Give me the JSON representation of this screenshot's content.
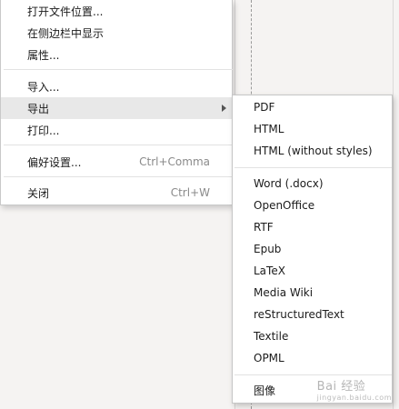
{
  "main_menu": {
    "items": [
      {
        "label": "打开文件位置..."
      },
      {
        "label": "在侧边栏中显示"
      },
      {
        "label": "属性..."
      },
      {
        "label": "导入..."
      },
      {
        "label": "导出"
      },
      {
        "label": "打印..."
      },
      {
        "label": "偏好设置...",
        "shortcut": "Ctrl+Comma"
      },
      {
        "label": "关闭",
        "shortcut": "Ctrl+W"
      }
    ]
  },
  "export_submenu": {
    "items": [
      {
        "label": "PDF"
      },
      {
        "label": "HTML"
      },
      {
        "label": "HTML (without styles)"
      },
      {
        "label": "Word (.docx)"
      },
      {
        "label": "OpenOffice"
      },
      {
        "label": "RTF"
      },
      {
        "label": "Epub"
      },
      {
        "label": "LaTeX"
      },
      {
        "label": "Media Wiki"
      },
      {
        "label": "reStructuredText"
      },
      {
        "label": "Textile"
      },
      {
        "label": "OPML"
      },
      {
        "label": "图像"
      }
    ]
  },
  "watermark": {
    "text": "Bai 经验",
    "sub": "jingyan.baidu.com"
  }
}
